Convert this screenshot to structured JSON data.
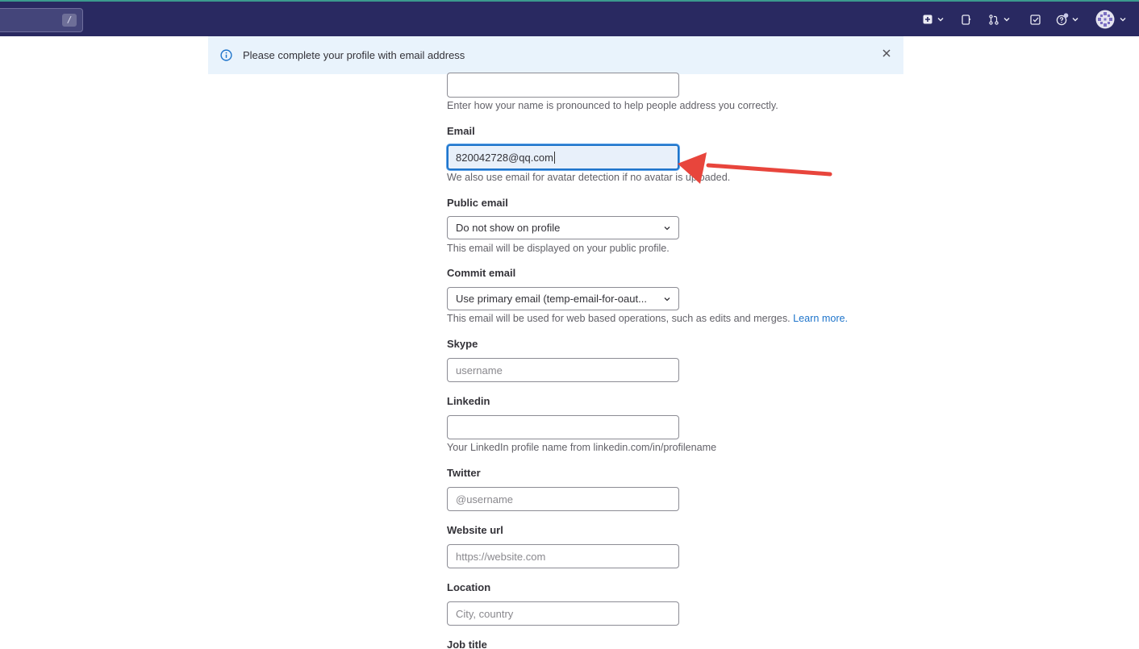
{
  "topbar": {
    "search_shortcut": "/",
    "icons": [
      "plus-square-icon",
      "chevron-down-icon",
      "issues-icon",
      "merge-request-icon",
      "chevron-down-icon",
      "todo-check-icon",
      "help-icon",
      "chevron-down-icon",
      "avatar",
      "chevron-down-icon"
    ]
  },
  "alert": {
    "message": "Please complete your profile with email address"
  },
  "form": {
    "pronunciation": {
      "value": "",
      "help": "Enter how your name is pronounced to help people address you correctly."
    },
    "email": {
      "label": "Email",
      "value": "820042728@qq.com",
      "help": "We also use email for avatar detection if no avatar is uploaded."
    },
    "public_email": {
      "label": "Public email",
      "selected": "Do not show on profile",
      "help": "This email will be displayed on your public profile."
    },
    "commit_email": {
      "label": "Commit email",
      "selected": "Use primary email (temp-email-for-oaut...",
      "help": "This email will be used for web based operations, such as edits and merges.",
      "link": "Learn more."
    },
    "skype": {
      "label": "Skype",
      "placeholder": "username"
    },
    "linkedin": {
      "label": "Linkedin",
      "value": "",
      "help": "Your LinkedIn profile name from linkedin.com/in/profilename"
    },
    "twitter": {
      "label": "Twitter",
      "placeholder": "@username"
    },
    "website": {
      "label": "Website url",
      "placeholder": "https://website.com"
    },
    "location": {
      "label": "Location",
      "placeholder": "City, country"
    },
    "job_title": {
      "label": "Job title"
    }
  },
  "colors": {
    "topbar": "#292961",
    "alert_bg": "#e9f3fc",
    "link": "#1f75cb",
    "annotation_arrow": "#e8453c"
  }
}
